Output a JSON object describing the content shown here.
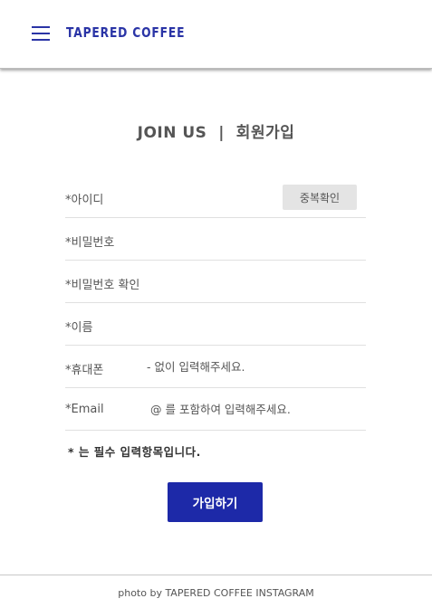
{
  "header": {
    "brand": "TAPERED COFFEE",
    "menu_icon": "hamburger-menu-icon"
  },
  "page": {
    "title": "JOIN US  |  회원가입"
  },
  "form": {
    "id_label": "*아이디",
    "duplicate_check_label": "중복확인",
    "password_label": "*비밀번호",
    "password_confirm_label": "*비밀번호 확인",
    "name_label": "*이름",
    "phone_label": "*휴대폰",
    "phone_placeholder": "- 없이 입력해주세요.",
    "email_label": "*Email",
    "email_placeholder": "@ 를 포함하여 입력해주세요.",
    "required_note": "* 는 필수 입력항목입니다.",
    "submit_label": "가입하기"
  },
  "footer": {
    "credit": "photo by TAPERED COFFEE INSTAGRAM"
  },
  "colors": {
    "brand": "#2a34a6",
    "button": "#1d29a8",
    "text": "#555555",
    "secondary_button": "#e4e4e4"
  }
}
